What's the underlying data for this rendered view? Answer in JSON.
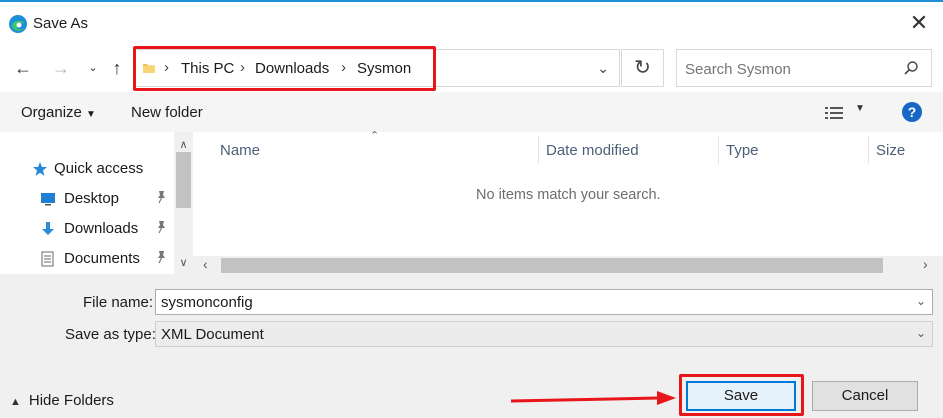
{
  "window": {
    "title": "Save As",
    "app_icon": "edge-icon",
    "close_icon": "close-icon"
  },
  "nav": {
    "back_icon": "arrow-left-icon",
    "forward_icon": "arrow-right-icon",
    "recent_icon": "chevron-down-icon",
    "up_icon": "arrow-up-icon",
    "breadcrumbs": [
      "This PC",
      "Downloads",
      "Sysmon"
    ],
    "refresh_icon": "refresh-icon",
    "search_placeholder": "Search Sysmon"
  },
  "toolbar": {
    "organize_label": "Organize",
    "new_folder_label": "New folder",
    "view_icon": "details-view-icon",
    "help_label": "?"
  },
  "sidebar": {
    "items": [
      {
        "label": "Quick access",
        "icon": "star-icon",
        "pinned": false
      },
      {
        "label": "Desktop",
        "icon": "desktop-icon",
        "pinned": true
      },
      {
        "label": "Downloads",
        "icon": "download-icon",
        "pinned": true
      },
      {
        "label": "Documents",
        "icon": "documents-icon",
        "pinned": true
      }
    ]
  },
  "files": {
    "columns": [
      "Name",
      "Date modified",
      "Type",
      "Size"
    ],
    "empty_message": "No items match your search."
  },
  "form": {
    "file_name_label": "File name:",
    "file_name_value": "sysmonconfig",
    "save_type_label": "Save as type:",
    "save_type_value": "XML Document"
  },
  "footer": {
    "hide_folders_label": "Hide Folders",
    "save_label": "Save",
    "cancel_label": "Cancel"
  },
  "colors": {
    "highlight": "#e8161b",
    "accent": "#0078d7",
    "help": "#1668c4"
  }
}
